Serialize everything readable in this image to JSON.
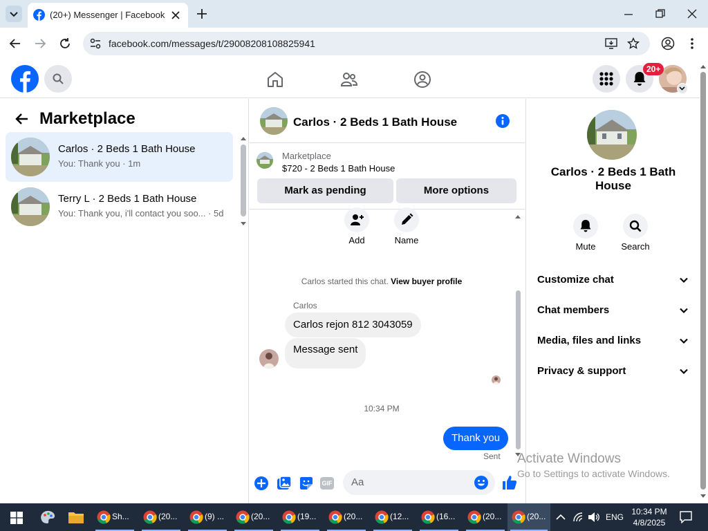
{
  "browser": {
    "tab_title": "(20+) Messenger | Facebook",
    "url": "facebook.com/messages/t/29008208108825941"
  },
  "header": {
    "notif_count": "20+"
  },
  "left": {
    "title": "Marketplace",
    "conversations": [
      {
        "title": "Carlos · 2 Beds 1 Bath House",
        "snippet": "You: Thank you · 1m",
        "selected": true
      },
      {
        "title": "Terry L · 2 Beds 1 Bath House",
        "snippet": "You: Thank you, i'll contact you soo... · 5d",
        "selected": false
      }
    ]
  },
  "chat": {
    "title": "Carlos · 2 Beds 1 Bath House",
    "listing": {
      "source": "Marketplace",
      "price_title": "$720 - 2 Beds 1 Bath House",
      "mark_pending": "Mark as pending",
      "more_options": "More options"
    },
    "actions": {
      "add": "Add",
      "name": "Name"
    },
    "started_text": "Carlos started this chat.",
    "view_profile": "View buyer profile",
    "sender_name": "Carlos",
    "messages": [
      {
        "text": "Carlos rejon 812 3043059",
        "from": "other"
      },
      {
        "text": "Message sent",
        "from": "other"
      }
    ],
    "timestamp": "10:34 PM",
    "my_message": "Thank you",
    "sent_status": "Sent",
    "composer_placeholder": "Aa"
  },
  "right": {
    "title": "Carlos · 2 Beds 1 Bath House",
    "mute": "Mute",
    "search": "Search",
    "sections": [
      "Customize chat",
      "Chat members",
      "Media, files and links",
      "Privacy & support"
    ]
  },
  "watermark": {
    "line1": "Activate Windows",
    "line2": "Go to Settings to activate Windows."
  },
  "taskbar": {
    "apps": [
      "Sh...",
      "(20...",
      "(9) ...",
      "(20...",
      "(19...",
      "(20...",
      "(12...",
      "(16...",
      "(20...",
      "(20..."
    ],
    "lang": "ENG",
    "time": "10:34 PM",
    "date": "4/8/2025"
  },
  "colors": {
    "fb_blue": "#0866ff",
    "badge_red": "#e41e3f"
  }
}
